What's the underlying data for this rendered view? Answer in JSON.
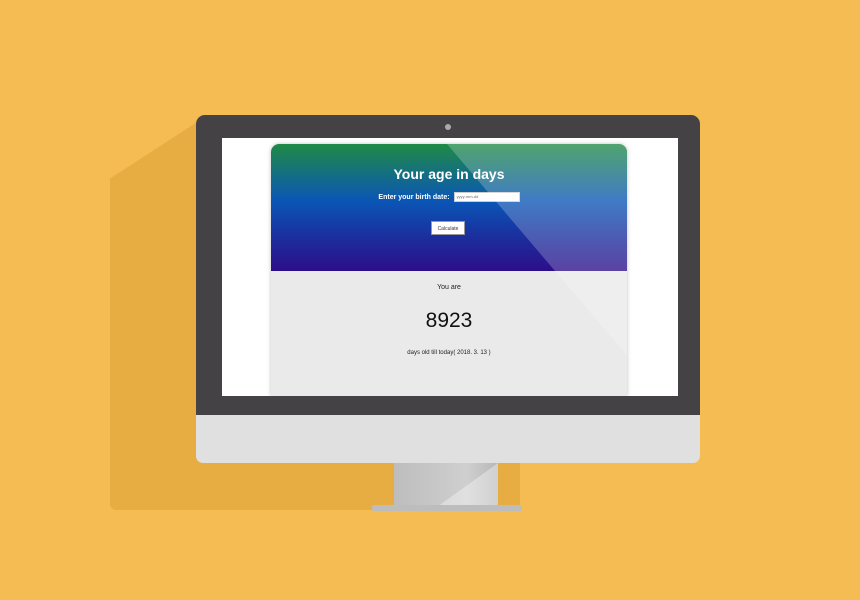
{
  "app": {
    "title": "Your age in days",
    "birth_date_label": "Enter your birth date:",
    "birth_date_placeholder": "yyyy-mm-dd",
    "calculate_label": "Calculate"
  },
  "result": {
    "prefix": "You are",
    "days": "8923",
    "suffix": "days old till today( 2018. 3. 13 )"
  },
  "colors": {
    "background": "#F4BC52",
    "bezel": "#444244",
    "hero_top": "#1f8a46",
    "hero_bottom": "#2d0e8a",
    "result_bg": "#eaeaea"
  }
}
